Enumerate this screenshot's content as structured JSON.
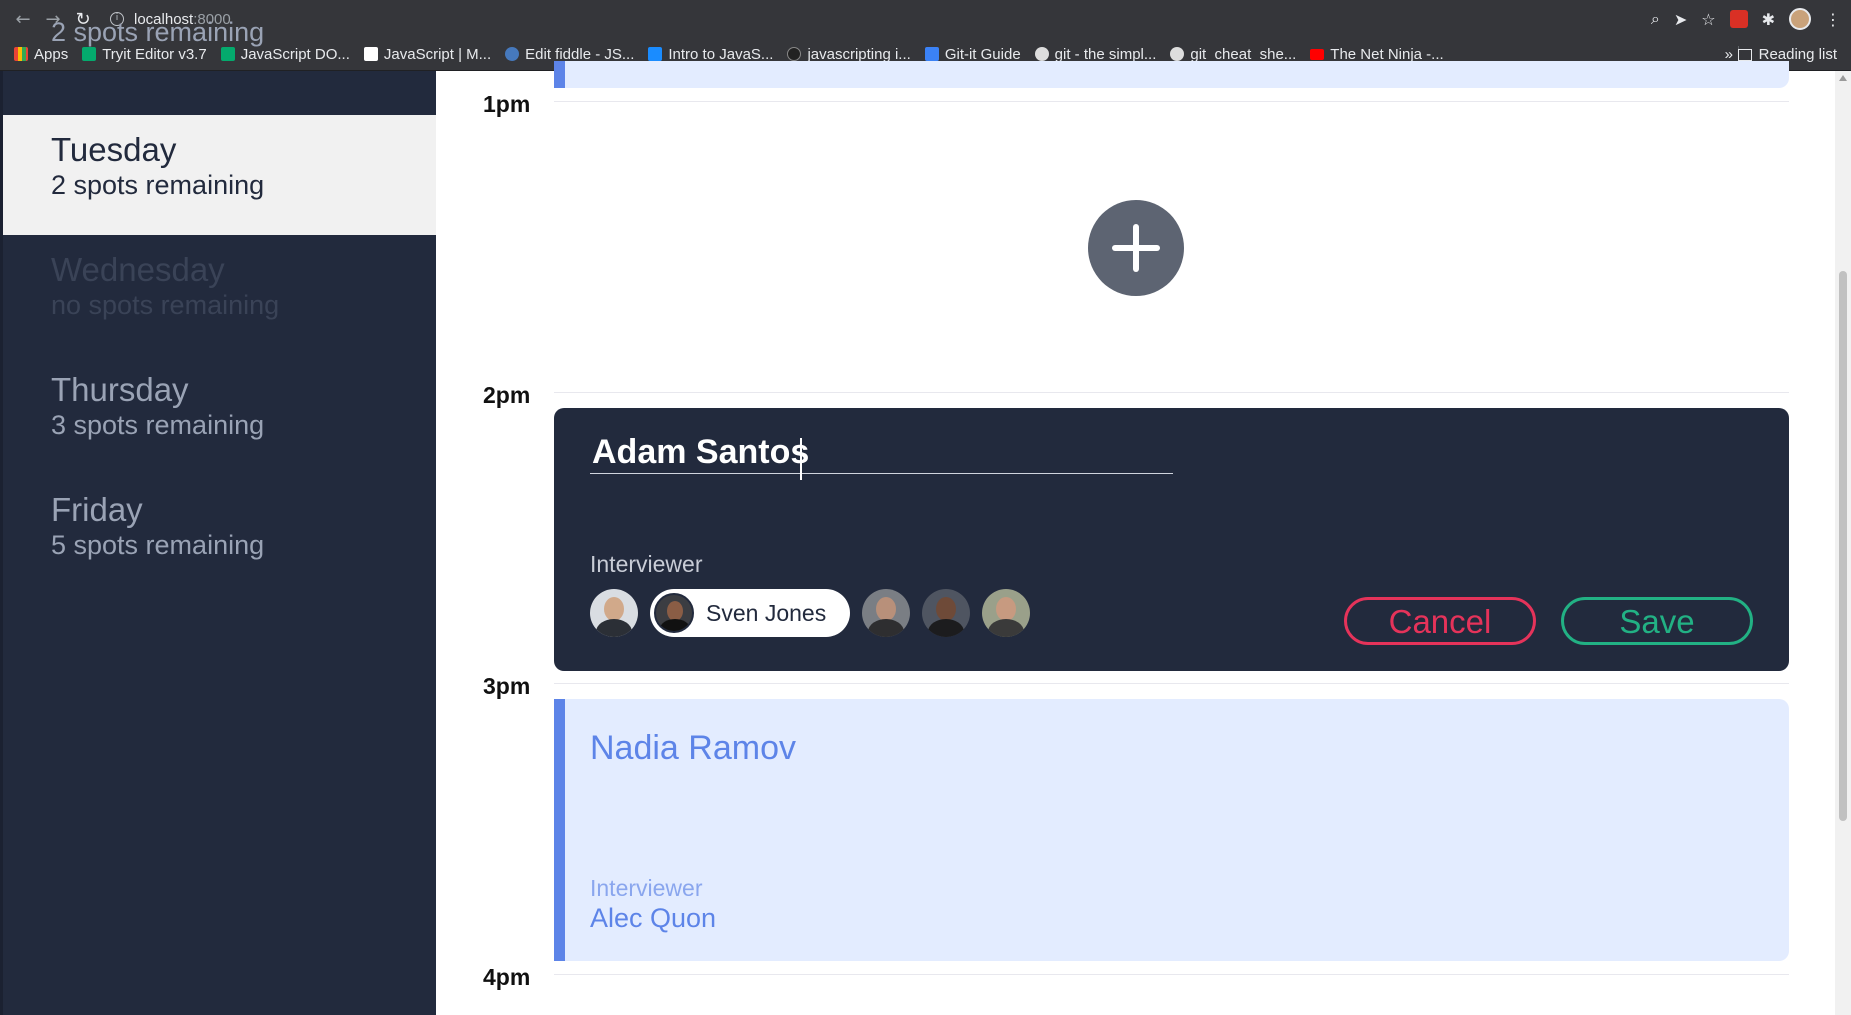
{
  "browser": {
    "url_host": "localhost",
    "url_port": ":8000",
    "bookmarks": [
      {
        "label": "Apps",
        "color": "#4285f4"
      },
      {
        "label": "Tryit Editor v3.7",
        "color": "#04aa6d"
      },
      {
        "label": "JavaScript DO...",
        "color": "#04aa6d"
      },
      {
        "label": "JavaScript | M...",
        "color": "#ffffff"
      },
      {
        "label": "Edit fiddle - JS...",
        "color": "#4679bd"
      },
      {
        "label": "Intro to JavaS...",
        "color": "#1a8cff"
      },
      {
        "label": "javascripting i...",
        "color": "#888888"
      },
      {
        "label": "Git-it Guide",
        "color": "#3b82f6"
      },
      {
        "label": "git - the simpl...",
        "color": "#dddddd"
      },
      {
        "label": "git_cheat_she...",
        "color": "#dddddd"
      },
      {
        "label": "The Net Ninja -...",
        "color": "#ff0000"
      }
    ],
    "more": "»",
    "reading_list": "Reading list"
  },
  "sidebar": {
    "days": [
      {
        "name": "",
        "spots": "2 spots remaining",
        "state": "normal"
      },
      {
        "name": "Tuesday",
        "spots": "2 spots remaining",
        "state": "selected"
      },
      {
        "name": "Wednesday",
        "spots": "no spots remaining",
        "state": "full"
      },
      {
        "name": "Thursday",
        "spots": "3 spots remaining",
        "state": "normal"
      },
      {
        "name": "Friday",
        "spots": "5 spots remaining",
        "state": "normal"
      }
    ]
  },
  "schedule": {
    "times": [
      "1pm",
      "2pm",
      "3pm",
      "4pm"
    ],
    "form": {
      "student_value": "Adam Santos",
      "interviewer_label": "Interviewer",
      "selected_interviewer": "Sven Jones",
      "cancel_label": "Cancel",
      "save_label": "Save"
    },
    "appointment": {
      "student": "Nadia Ramov",
      "interviewer_label": "Interviewer",
      "interviewer": "Alec Quon"
    }
  },
  "colors": {
    "sidebar_bg": "#222a3d",
    "accent_blue": "#5d84e8",
    "cancel_red": "#e5335a",
    "save_green": "#22b184"
  }
}
